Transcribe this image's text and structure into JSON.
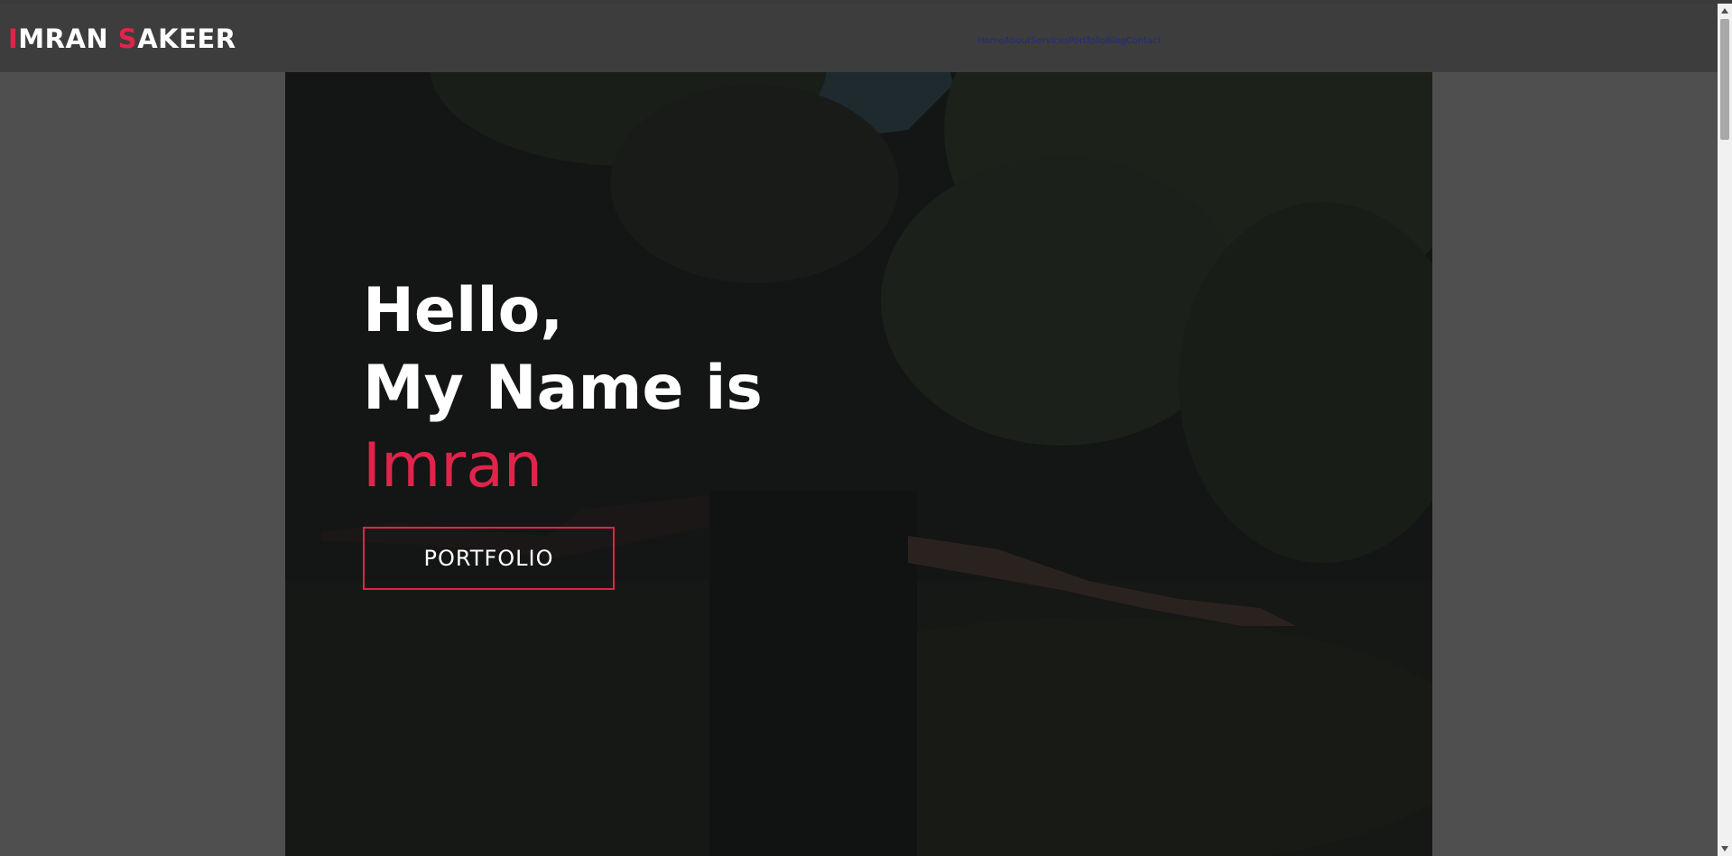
{
  "header": {
    "logo_first_initial": "I",
    "logo_first_rest": "MRAN ",
    "logo_last_initial": "S",
    "logo_last_rest": "AKEER",
    "nav_items": [
      "Home",
      "About",
      "Services",
      "Portfolio",
      "Blog",
      "Contact"
    ]
  },
  "hero": {
    "greeting": "Hello,",
    "intro": "My Name is",
    "name": "Imran",
    "button_label": "PORTFOLIO"
  },
  "colors": {
    "accent": "#e0244a",
    "page_background": "#4f4f4f",
    "header_background": "#3d3d3d",
    "hero_overlay": "#141515",
    "nav_link": "#1f2b80"
  },
  "icons": {
    "scroll_up": "triangle-up-icon",
    "scroll_down": "triangle-down-icon"
  }
}
